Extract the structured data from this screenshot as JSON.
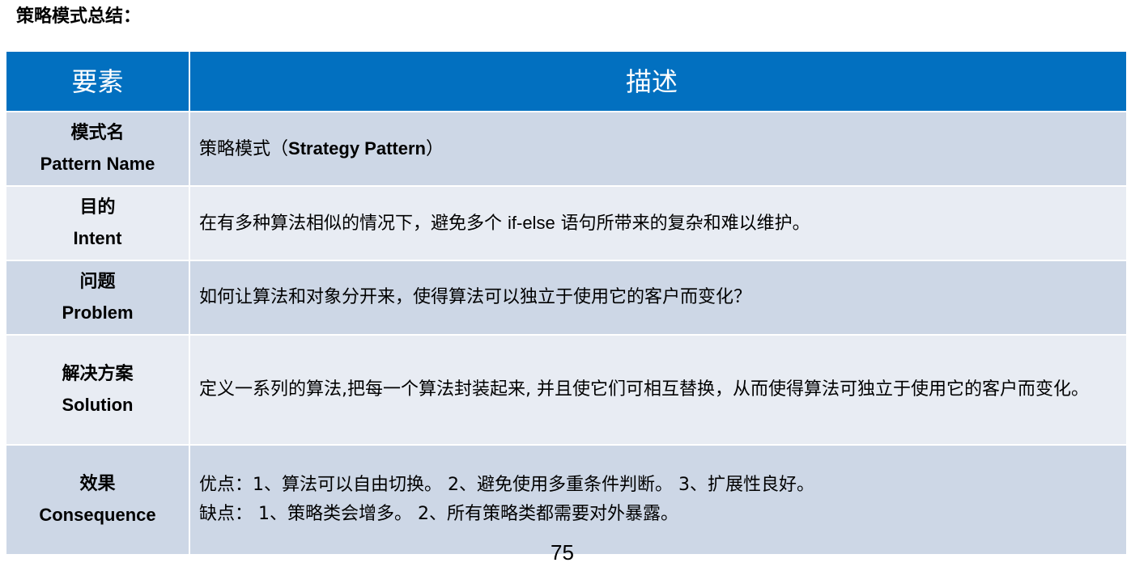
{
  "page_title": "策略模式总结：",
  "table": {
    "header": {
      "element_label": "要素",
      "description_label": "描述"
    },
    "rows": [
      {
        "name_cn": "模式名",
        "name_en": "Pattern Name",
        "desc_prefix": "策略模式（",
        "desc_bold": "Strategy Pattern",
        "desc_suffix": "）"
      },
      {
        "name_cn": "目的",
        "name_en": "Intent",
        "desc_part1": "在有多种算法相似的情况下，避免多个 ",
        "desc_code": "if-else",
        "desc_part2": " 语句所带来的复杂和难以维护。"
      },
      {
        "name_cn": "问题",
        "name_en": "Problem",
        "desc": "如何让算法和对象分开来，使得算法可以独立于使用它的客户而变化？"
      },
      {
        "name_cn": "解决方案",
        "name_en": "Solution",
        "desc": "定义一系列的算法,把每一个算法封装起来, 并且使它们可相互替换，从而使得算法可独立于使用它的客户而变化。"
      },
      {
        "name_cn": "效果",
        "name_en": "Consequence",
        "desc_line1": "优点：1、算法可以自由切换。 2、避免使用多重条件判断。 3、扩展性良好。",
        "desc_line2": "缺点： 1、策略类会增多。 2、所有策略类都需要对外暴露。"
      }
    ]
  },
  "page_number": "75"
}
